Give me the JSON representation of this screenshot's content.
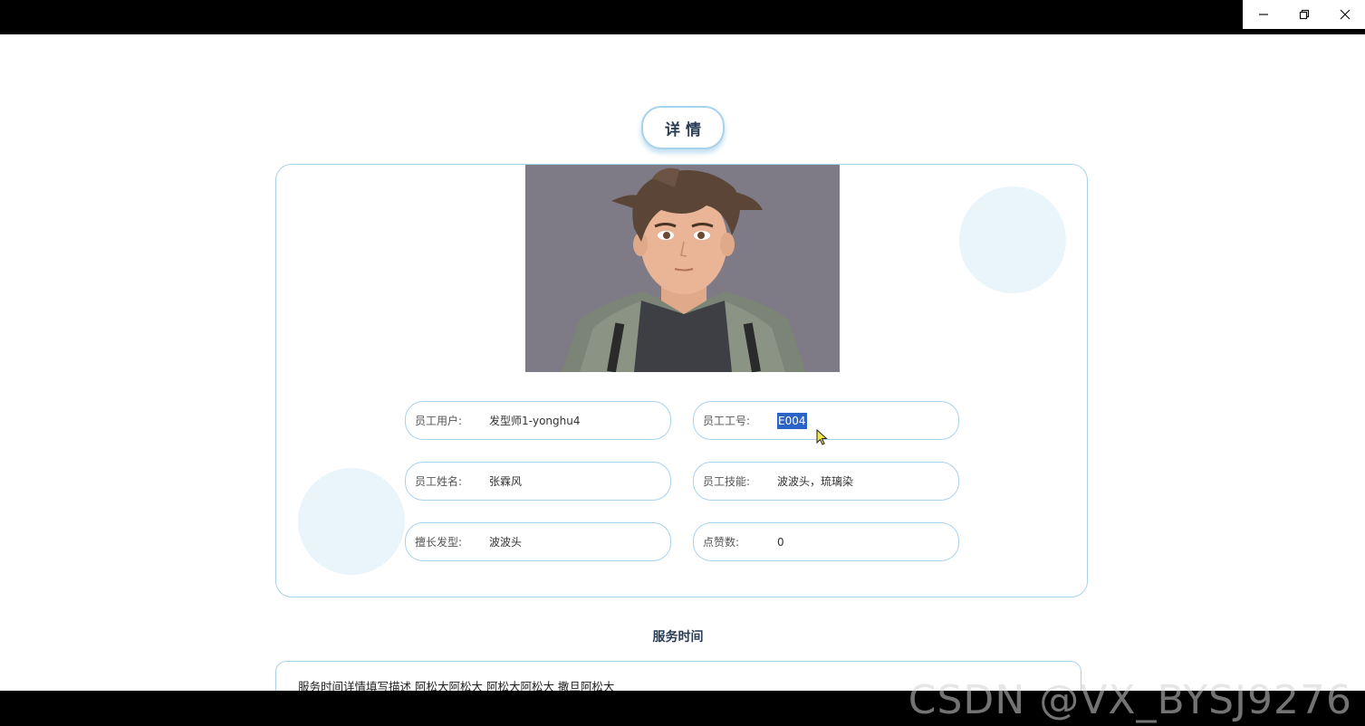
{
  "window": {
    "controls": {
      "minimize": "—",
      "restore": "❐",
      "close": "✕"
    }
  },
  "title": "详情",
  "fields": [
    {
      "label": "员工用户:",
      "value": "发型师1-yonghu4"
    },
    {
      "label": "员工工号:",
      "value": "E004"
    },
    {
      "label": "员工姓名:",
      "value": "张霖风"
    },
    {
      "label": "员工技能:",
      "value": "波波头，琉璃染"
    },
    {
      "label": "擅长发型:",
      "value": "波波头"
    },
    {
      "label": "点赞数:",
      "value": "0"
    }
  ],
  "service": {
    "title": "服务时间",
    "content": "服务时间详情填写描述 阿松大阿松大 阿松大阿松大 撒旦阿松大"
  },
  "watermark": "CSDN @VX_BYSJ9276",
  "colors": {
    "accent_border": "#a8d2ec",
    "deco_circle": "#eaf5fb",
    "selection": "#2b63c7"
  }
}
